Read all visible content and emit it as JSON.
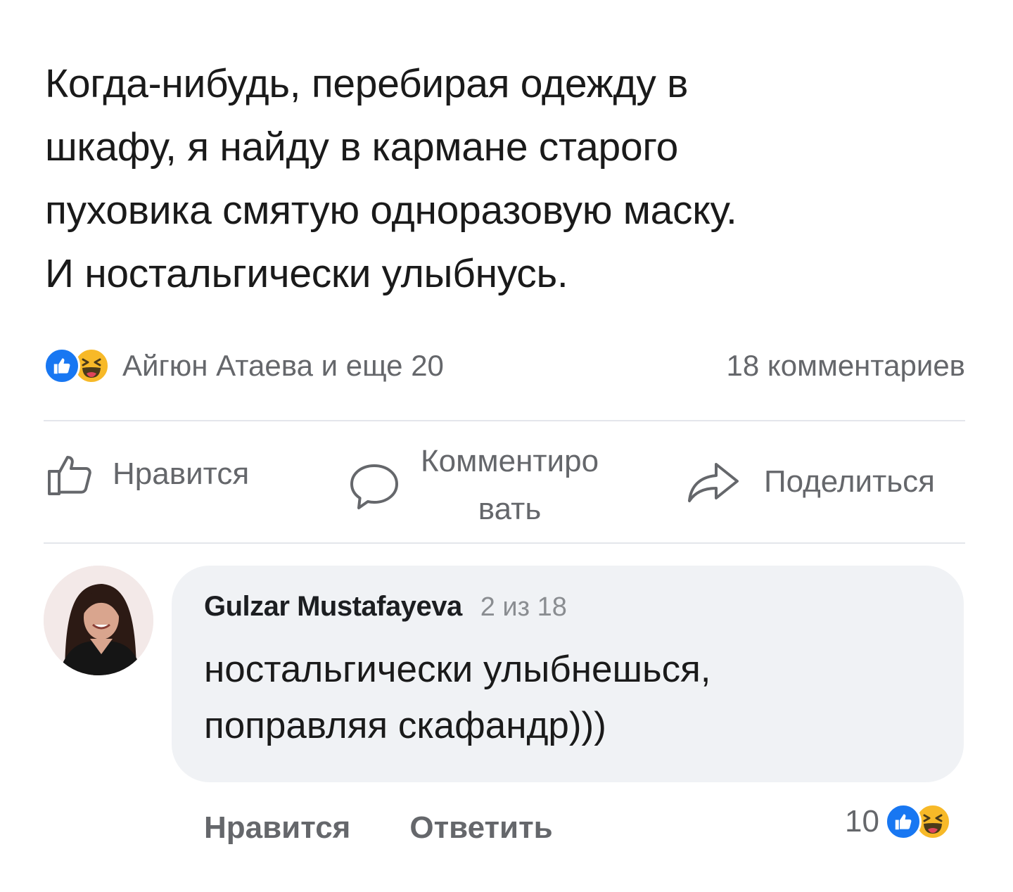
{
  "post": {
    "text_lines": [
      "Когда-нибудь, перебирая одежду в",
      "шкафу, я найду в кармане старого",
      "пуховика смятую одноразовую маску.",
      "И ностальгически улыбнусь."
    ]
  },
  "reactions": {
    "icons": [
      "like-icon",
      "haha-icon"
    ],
    "names": "Айгюн Атаева и еще 20",
    "comments_count": "18 комментариев"
  },
  "actions": {
    "like_label": "Нравится",
    "comment_label_line1": "Комментиро",
    "comment_label_line2": "вать",
    "share_label": "Поделиться"
  },
  "comment": {
    "author": "Gulzar Mustafayeva",
    "index": "2 из 18",
    "text_lines": [
      "ностальгически улыбнешься,",
      "поправляя скафандр)))"
    ],
    "like_label": "Нравится",
    "reply_label": "Ответить",
    "reaction_count": "10",
    "reaction_icons": [
      "like-icon",
      "haha-icon"
    ]
  },
  "colors": {
    "like_blue": "#1877f2",
    "haha_yellow": "#f7b928",
    "secondary_text": "#65676b",
    "bubble_bg": "#f0f2f5"
  }
}
